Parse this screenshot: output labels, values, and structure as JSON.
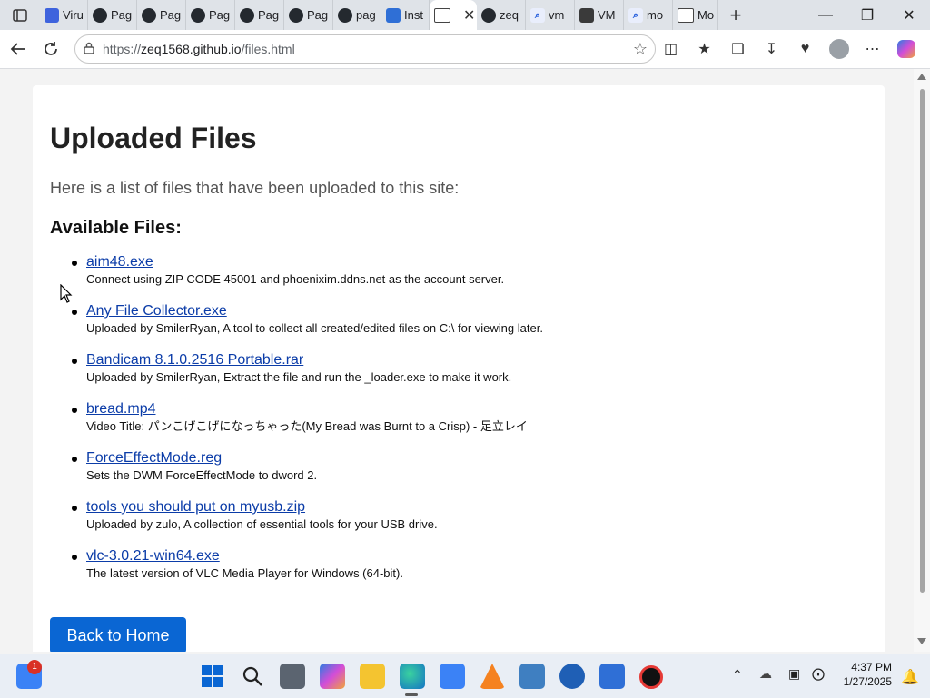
{
  "browser": {
    "tabs": [
      {
        "title": "Viru",
        "icon": "virustotal-icon"
      },
      {
        "title": "Pag",
        "icon": "github-icon"
      },
      {
        "title": "Pag",
        "icon": "github-icon"
      },
      {
        "title": "Pag",
        "icon": "github-icon"
      },
      {
        "title": "Pag",
        "icon": "github-icon"
      },
      {
        "title": "Pag",
        "icon": "github-icon"
      },
      {
        "title": "pag",
        "icon": "github-icon"
      },
      {
        "title": "Inst",
        "icon": "bing-icon"
      },
      {
        "title": "",
        "icon": "page-icon",
        "active": true
      },
      {
        "title": "zeq",
        "icon": "github-icon"
      },
      {
        "title": "vm",
        "icon": "search-icon"
      },
      {
        "title": "VM",
        "icon": "vm-icon"
      },
      {
        "title": "mo",
        "icon": "search-icon"
      },
      {
        "title": "Mo",
        "icon": "page-icon"
      }
    ],
    "address": {
      "scheme": "https://",
      "host": "zeq1568.github.io",
      "path": "/files.html"
    }
  },
  "page": {
    "title": "Uploaded Files",
    "intro": "Here is a list of files that have been uploaded to this site:",
    "section_heading": "Available Files:",
    "files": [
      {
        "name": "aim48.exe",
        "desc": "Connect using ZIP CODE 45001 and phoenixim.ddns.net as the account server."
      },
      {
        "name": "Any File Collector.exe",
        "desc": "Uploaded by SmilerRyan, A tool to collect all created/edited files on C:\\ for viewing later."
      },
      {
        "name": "Bandicam 8.1.0.2516 Portable.rar",
        "desc": "Uploaded by SmilerRyan, Extract the file and run the _loader.exe to make it work."
      },
      {
        "name": "bread.mp4",
        "desc": "Video Title: パンこげこげになっちゃった(My Bread was Burnt to a Crisp) - 足立レイ"
      },
      {
        "name": "ForceEffectMode.reg",
        "desc": "Sets the DWM ForceEffectMode to dword 2."
      },
      {
        "name": "tools you should put on myusb.zip",
        "desc": "Uploaded by zulo, A collection of essential tools for your USB drive."
      },
      {
        "name": "vlc-3.0.21-win64.exe",
        "desc": "The latest version of VLC Media Player for Windows (64-bit)."
      }
    ],
    "home_button": "Back to Home"
  },
  "taskbar": {
    "badge": "1",
    "time": "4:37 PM",
    "date": "1/27/2025"
  },
  "colors": {
    "link": "#0b3ca8",
    "button": "#0a66d3",
    "accent": "#1a56db"
  }
}
